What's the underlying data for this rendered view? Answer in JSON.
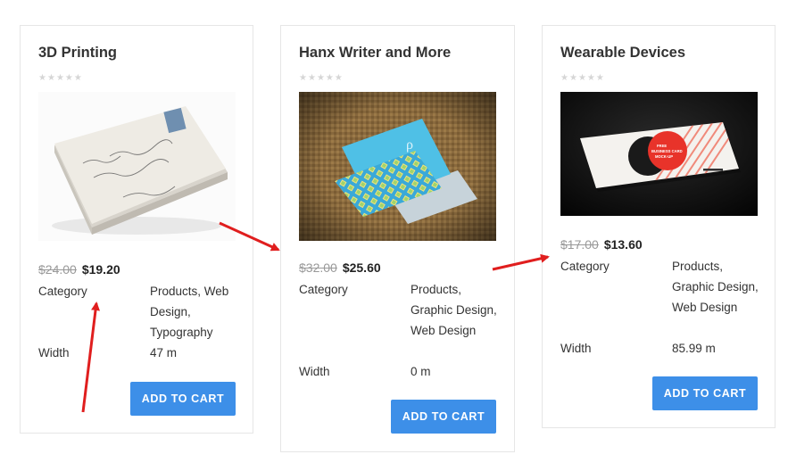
{
  "products": [
    {
      "title": "3D Printing",
      "old_price": "$24.00",
      "new_price": "$19.20",
      "category_label": "Category",
      "category_value": "Products, Web Design, Typography",
      "width_label": "Width",
      "width_value": "47 m",
      "button_label": "ADD TO CART",
      "image": "vintage-envelope-stack-image"
    },
    {
      "title": "Hanx Writer and More",
      "old_price": "$32.00",
      "new_price": "$25.60",
      "category_label": "Category",
      "category_value": "Products, Graphic Design, Web Design",
      "width_label": "Width",
      "width_value": "0 m",
      "button_label": "ADD TO CART",
      "image": "business-cards-on-burlap-image"
    },
    {
      "title": "Wearable Devices",
      "old_price": "$17.00",
      "new_price": "$13.60",
      "category_label": "Category",
      "category_value": "Products, Graphic Design, Web Design",
      "width_label": "Width",
      "width_value": "85.99 m",
      "button_label": "ADD TO CART",
      "image": "business-card-mockup-image",
      "image_text": "FREE BUSINESS CARD MOCK-UP"
    }
  ],
  "rating_stars": 5,
  "colors": {
    "button": "#3d8fe8",
    "annotation_arrow": "#e01e1e",
    "old_price": "#999999",
    "star_empty": "#d6d6d6"
  }
}
